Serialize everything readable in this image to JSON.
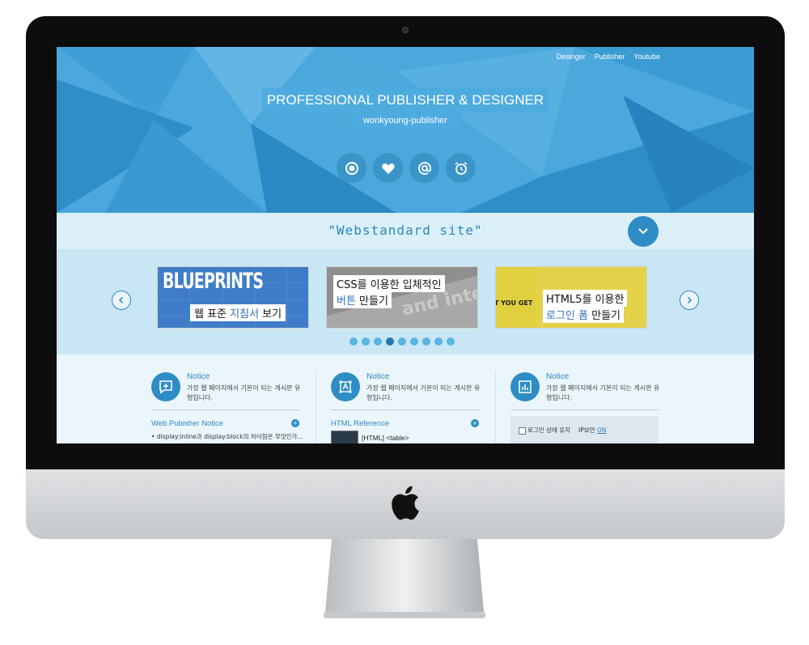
{
  "nav": {
    "items": [
      "Desinger",
      "Publisher",
      "Youtube"
    ]
  },
  "hero": {
    "title": "PROFESSIONAL PUBLISHER & DESIGNER",
    "subtitle": "wonkyoung-publisher",
    "icons": [
      "record-icon",
      "heart-icon",
      "at-icon",
      "alarm-icon"
    ]
  },
  "tagline": "\"Webstandard site\"",
  "slides": [
    {
      "line1": "BLUEPRINTS",
      "line2a": "웹 표준 ",
      "line2b": "지침서",
      "line2c": " 보기"
    },
    {
      "line1": "CSS를 이용한 입체적인",
      "line2a": "버튼",
      "line2b": " 만들기",
      "bg": "and inte"
    },
    {
      "line1": "HTML5를 이용한",
      "line2a": "로그인 폼",
      "line2b": " 만들기",
      "side": "T YOU GET"
    }
  ],
  "dots": {
    "count": 9,
    "active": 3
  },
  "columns": [
    {
      "head": "Notice",
      "desc": "가장 웹 페이지에서 기본이 되는 게시판 유형입니다.",
      "section": "Web Pubisher Notice",
      "item": "• display:inline과 display:block의 차이점은 무엇인가..."
    },
    {
      "head": "Notice",
      "desc": "가장 웹 페이지에서 기본이 되는 게시판 유형입니다.",
      "section": "HTML Reference",
      "item": "[HTML] <table>"
    },
    {
      "head": "Notice",
      "desc": "가장 웹 페이지에서 기본이 되는 게시판 유형입니다.",
      "login_keep": "로그인 상태 유지",
      "ip_label": "IP보안",
      "ip_state": "ON"
    }
  ],
  "colors": {
    "accent": "#2d8dc4",
    "hero": "#4aa8dc",
    "band": "#daeff8",
    "slider": "#c9e6f4"
  }
}
